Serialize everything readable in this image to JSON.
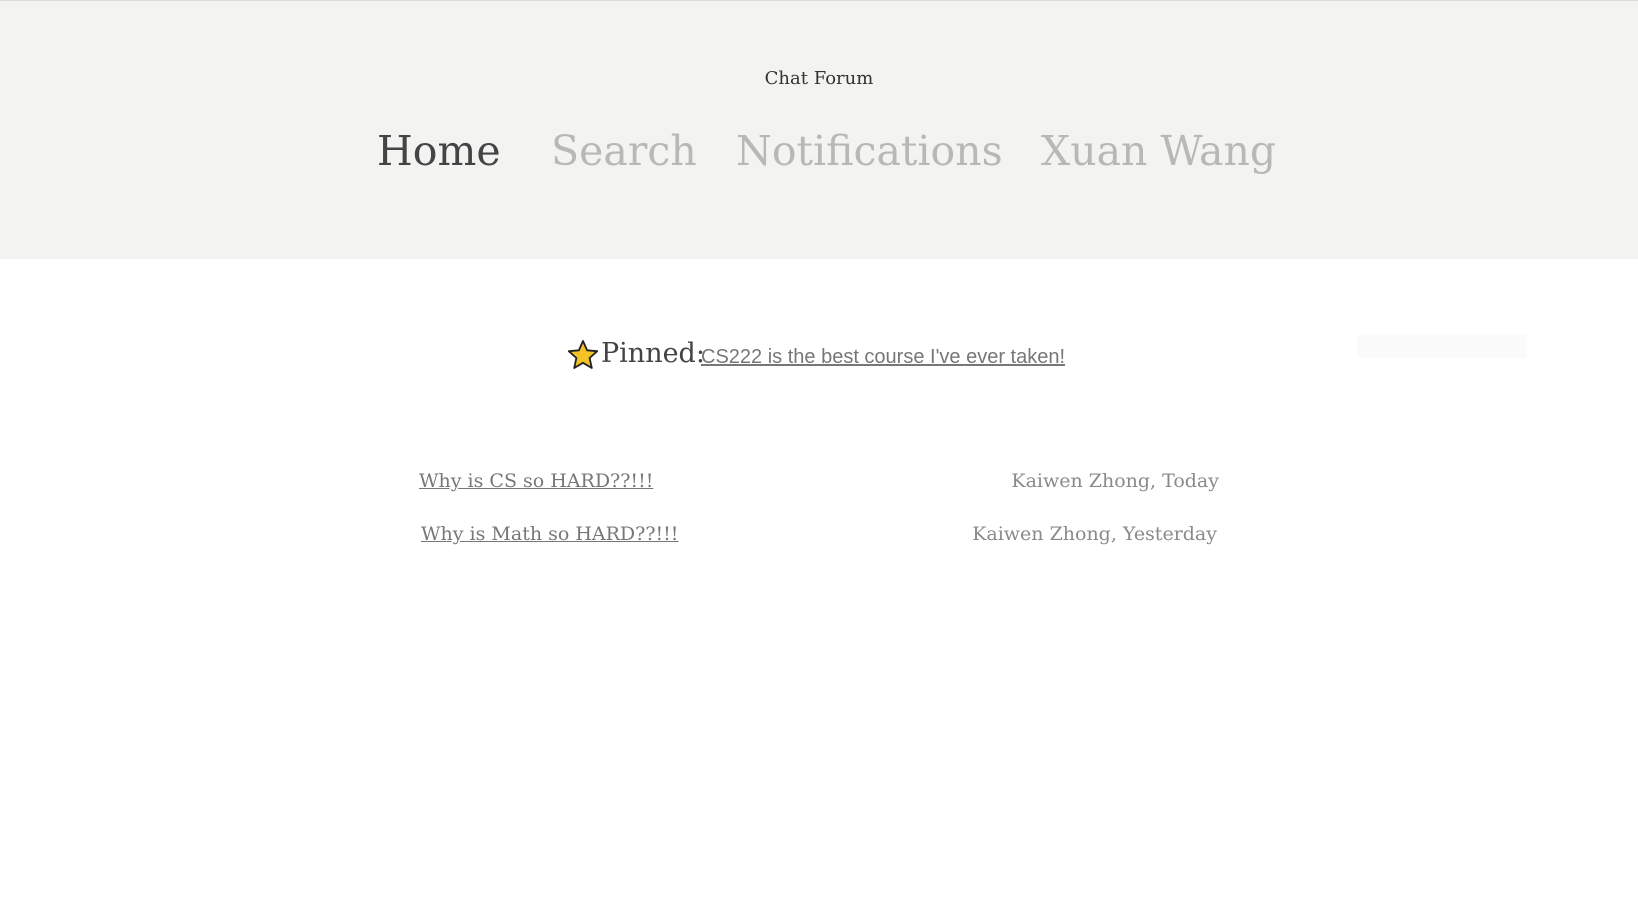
{
  "header": {
    "site_title": "Chat Forum",
    "nav": [
      {
        "label": "Home",
        "active": true
      },
      {
        "label": "Search",
        "active": false
      },
      {
        "label": "Notifications",
        "active": false
      },
      {
        "label": "Xuan Wang",
        "active": false
      }
    ]
  },
  "pinned": {
    "icon": "star-icon",
    "label": "Pinned:",
    "link_text": " CS222 is the best course I've ever taken!"
  },
  "threads": [
    {
      "title": "Why is CS so HARD??!!!   ",
      "meta": "Kaiwen Zhong, Today"
    },
    {
      "title": "Why is Math so HARD??!!!",
      "meta": "Kaiwen Zhong, Yesterday"
    }
  ],
  "colors": {
    "header_bg": "#f3f3f1",
    "nav_active": "#444444",
    "nav_inactive": "#b8b8b6",
    "star_fill": "#f5c227",
    "link": "#777777"
  }
}
